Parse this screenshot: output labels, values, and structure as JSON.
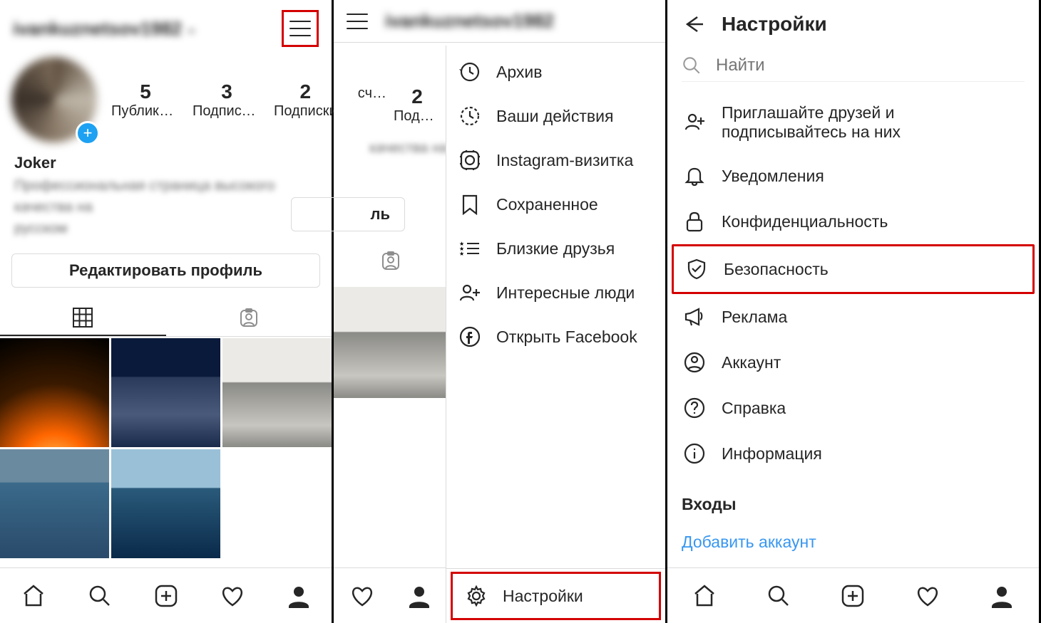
{
  "panel1": {
    "username": "ivankuznetsov1982",
    "stats": [
      {
        "num": "5",
        "label": "Публика…"
      },
      {
        "num": "3",
        "label": "Подписч…"
      },
      {
        "num": "2",
        "label": "Подписки"
      }
    ],
    "bio_name": "Joker",
    "bio_line1": "Профессиональная страница высокого качества на",
    "bio_line2": "русском",
    "edit_button": "Редактировать профиль"
  },
  "panel2": {
    "username": "ivankuznetsov1982",
    "frag_stats": [
      {
        "num": "",
        "label": "сч…"
      },
      {
        "num": "2",
        "label": "Подписки"
      }
    ],
    "frag_bio1": "качества на",
    "frag_edit": "ль",
    "drawer": [
      {
        "icon": "archive",
        "label": "Архив"
      },
      {
        "icon": "activity",
        "label": "Ваши действия"
      },
      {
        "icon": "nametag",
        "label": "Instagram-визитка"
      },
      {
        "icon": "saved",
        "label": "Сохраненное"
      },
      {
        "icon": "closefriends",
        "label": "Близкие друзья"
      },
      {
        "icon": "discover",
        "label": "Интересные люди"
      },
      {
        "icon": "facebook",
        "label": "Открыть Facebook"
      }
    ],
    "settings_label": "Настройки"
  },
  "panel3": {
    "title": "Настройки",
    "search_placeholder": "Найти",
    "items": [
      {
        "icon": "invite",
        "label": "Приглашайте друзей и подписывайтесь на них",
        "hl": false
      },
      {
        "icon": "bell",
        "label": "Уведомления",
        "hl": false
      },
      {
        "icon": "lock",
        "label": "Конфиденциальность",
        "hl": false
      },
      {
        "icon": "shield",
        "label": "Безопасность",
        "hl": true
      },
      {
        "icon": "ads",
        "label": "Реклама",
        "hl": false
      },
      {
        "icon": "account",
        "label": "Аккаунт",
        "hl": false
      },
      {
        "icon": "help",
        "label": "Справка",
        "hl": false
      },
      {
        "icon": "info",
        "label": "Информация",
        "hl": false
      }
    ],
    "section_heading": "Входы",
    "add_account": "Добавить аккаунт"
  }
}
